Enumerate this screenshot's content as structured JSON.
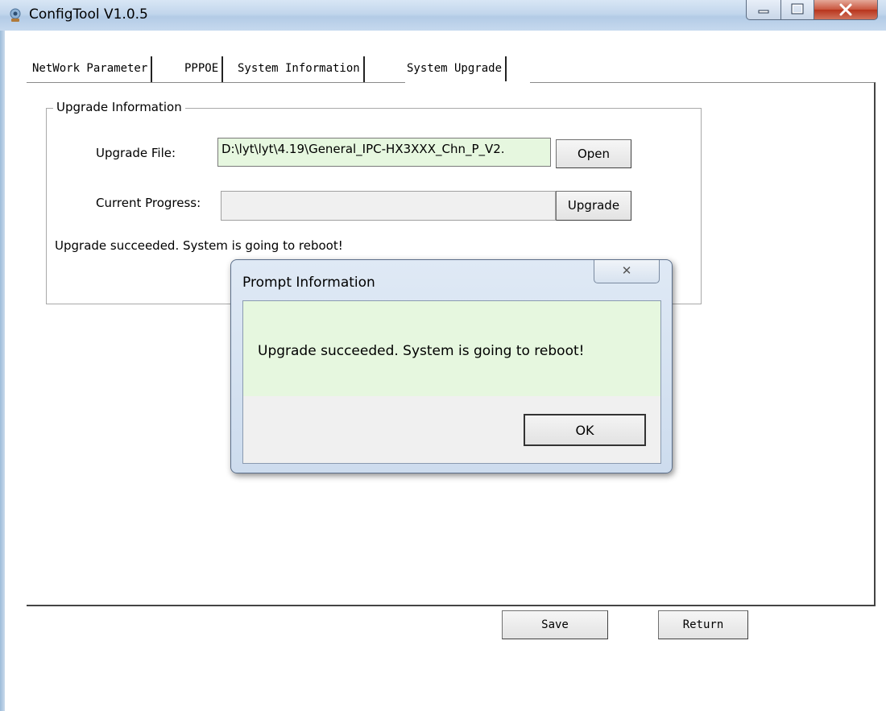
{
  "window": {
    "title": "ConfigTool V1.0.5"
  },
  "tabs": [
    {
      "label": "NetWork Parameter"
    },
    {
      "label": "PPPOE"
    },
    {
      "label": "System Information"
    },
    {
      "label": "System Upgrade"
    }
  ],
  "upgrade": {
    "group_title": "Upgrade Information",
    "file_label": "Upgrade File:",
    "file_value": "D:\\lyt\\lyt\\4.19\\General_IPC-HX3XXX_Chn_P_V2.",
    "open_label": "Open",
    "progress_label": "Current Progress:",
    "progress_fraction": 0,
    "upgrade_label": "Upgrade",
    "status_message": "Upgrade succeeded. System is going to reboot!"
  },
  "footer": {
    "save_label": "Save",
    "return_label": "Return"
  },
  "dialog": {
    "title": "Prompt Information",
    "close_glyph": "✕",
    "message": "Upgrade succeeded. System is going to reboot!",
    "ok_label": "OK"
  },
  "colors": {
    "field_bg": "#e6f7df",
    "title_bar": "#c2d6ec",
    "close_red": "#c9553d"
  }
}
